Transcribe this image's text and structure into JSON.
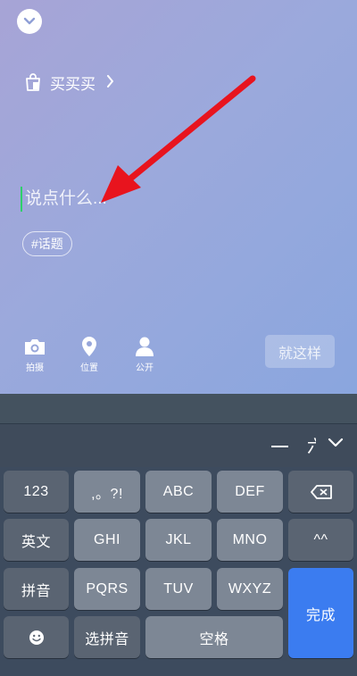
{
  "compose": {
    "category_label": "买买买",
    "input_placeholder": "说点什么...",
    "topic_chip": "#话题",
    "tools": [
      {
        "label": "拍摄",
        "icon": "camera-icon"
      },
      {
        "label": "位置",
        "icon": "location-pin-icon"
      },
      {
        "label": "公开",
        "icon": "person-icon"
      }
    ],
    "submit_label": "就这样"
  },
  "keyboard": {
    "candidate_partial": "六",
    "rows": [
      [
        "123",
        ",。?!",
        "ABC",
        "DEF",
        "backspace-icon"
      ],
      [
        "英文",
        "GHI",
        "JKL",
        "MNO",
        "^^"
      ],
      [
        "拼音",
        "PQRS",
        "TUV",
        "WXYZ",
        "完成"
      ],
      [
        "emoji-icon",
        "选拼音",
        "空格"
      ]
    ],
    "done_color": "#3b7cf0"
  },
  "annotation": {
    "arrow_color": "#e8141e"
  }
}
